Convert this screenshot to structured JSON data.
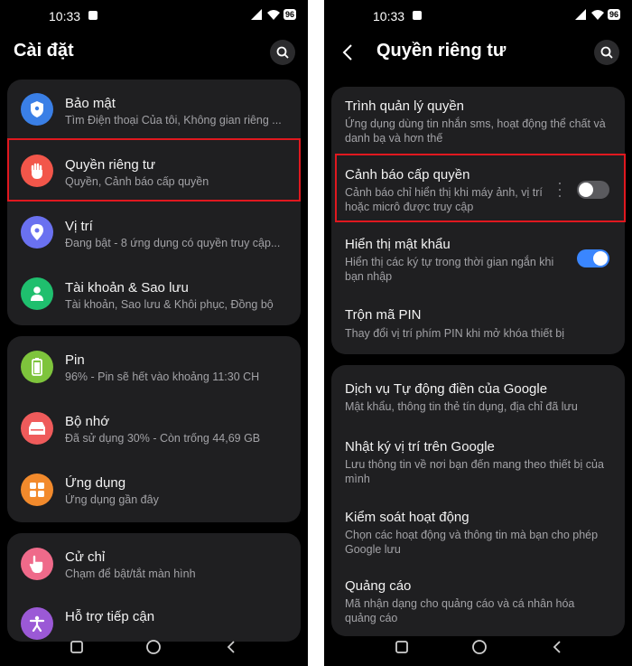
{
  "status": {
    "time": "10:33",
    "battery": "96"
  },
  "left": {
    "title": "Cài đặt",
    "items": [
      {
        "title": "Bảo mật",
        "subtitle": "Tìm Điện thoại Của tôi, Không gian riêng ...",
        "icon": "shield-icon",
        "color": "#3a7fe6"
      },
      {
        "title": "Quyền riêng tư",
        "subtitle": "Quyền, Cảnh báo cấp quyền",
        "icon": "hand-icon",
        "color": "#f2564a"
      },
      {
        "title": "Vị trí",
        "subtitle": "Đang bật - 8 ứng dụng có quyền truy cập...",
        "icon": "location-pin-icon",
        "color": "#6a71f0"
      },
      {
        "title": "Tài khoản & Sao lưu",
        "subtitle": "Tài khoản, Sao lưu & Khôi phục, Đồng bộ",
        "icon": "person-icon",
        "color": "#1fbf6e"
      },
      {
        "title": "Pin",
        "subtitle": "96% - Pin sẽ hết vào khoảng 11:30 CH",
        "icon": "battery-icon",
        "color": "#7ec43c"
      },
      {
        "title": "Bộ nhớ",
        "subtitle": "Đã sử dụng 30% - Còn trống 44,69 GB",
        "icon": "storage-icon",
        "color": "#ef5b5b"
      },
      {
        "title": "Ứng dụng",
        "subtitle": "Ứng dụng gần đây",
        "icon": "apps-grid-icon",
        "color": "#f28a2c"
      },
      {
        "title": "Cử chỉ",
        "subtitle": "Chạm để bật/tắt màn hình",
        "icon": "gesture-hand-icon",
        "color": "#ef6a8a"
      },
      {
        "title": "Hỗ trợ tiếp cận",
        "subtitle": "",
        "icon": "accessibility-icon",
        "color": "#9b59d6"
      }
    ]
  },
  "right": {
    "title": "Quyền riêng tư",
    "items": [
      {
        "title": "Trình quản lý quyền",
        "subtitle": "Ứng dụng dùng tin nhắn sms, hoạt động thể chất và danh bạ và hơn thế"
      },
      {
        "title": "Cảnh báo cấp quyền",
        "subtitle": "Cảnh báo chỉ hiển thị khi máy ảnh, vị trí hoặc micrô được truy cập",
        "toggle": false
      },
      {
        "title": "Hiển thị mật khẩu",
        "subtitle": "Hiển thị các ký tự trong thời gian ngắn khi bạn nhập",
        "toggle": true
      },
      {
        "title": "Trộn mã PIN",
        "subtitle": "Thay đổi vị trí phím PIN khi mở khóa thiết bị"
      },
      {
        "title": "Dịch vụ Tự động điền của Google",
        "subtitle": "Mật khẩu, thông tin thẻ tín dụng, địa chỉ đã lưu"
      },
      {
        "title": "Nhật ký vị trí trên Google",
        "subtitle": "Lưu thông tin về nơi bạn đến mang theo thiết bị của mình"
      },
      {
        "title": "Kiểm soát hoạt động",
        "subtitle": "Chọn các hoạt động và thông tin mà bạn cho phép Google lưu"
      },
      {
        "title": "Quảng cáo",
        "subtitle": "Mã nhận dạng cho quảng cáo và cá nhân hóa quảng cáo"
      }
    ]
  },
  "colors": {
    "toggle_on": "#3a86ff",
    "toggle_off": "#5a5a5e",
    "highlight": "#e0181f"
  }
}
